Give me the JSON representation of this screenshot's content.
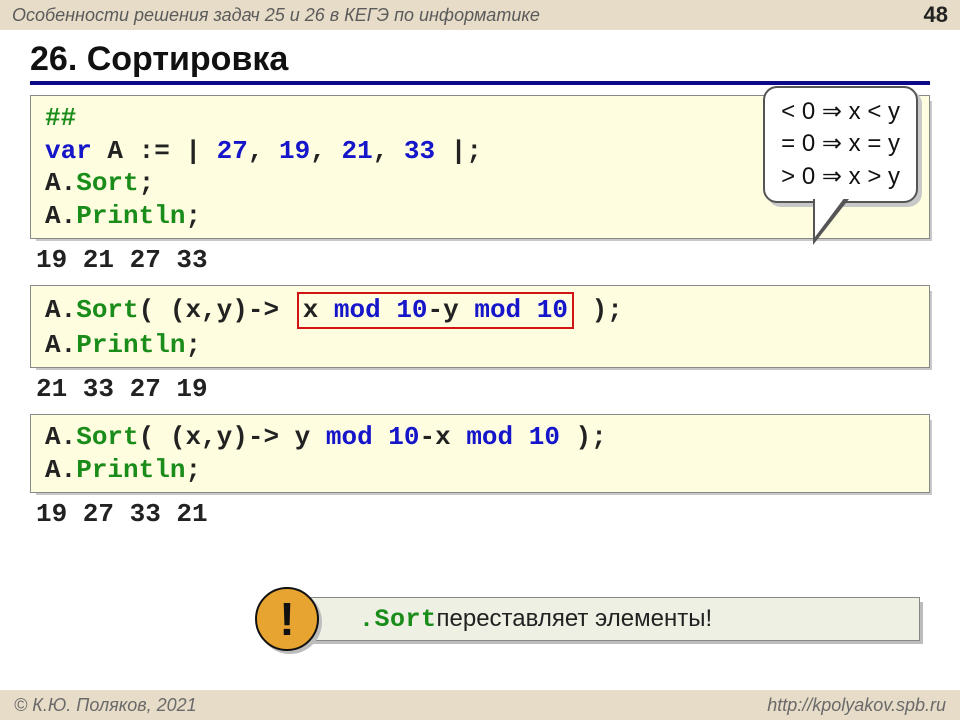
{
  "header": {
    "subtitle": "Особенности решения задач 25 и 26 в КЕГЭ по информатике",
    "page": "48"
  },
  "title": "26. Сортировка",
  "code1": {
    "l1": "##",
    "l2a": "var",
    "l2b": " A := |",
    "l2c": " 27",
    "l2d": ",",
    "l2e": " 19",
    "l2f": ",",
    "l2g": " 21",
    "l2h": ",",
    "l2i": " 33",
    "l2j": " |;",
    "l3a": "A.",
    "l3b": "Sort",
    "l3c": ";",
    "l4a": "A.",
    "l4b": "Println",
    "l4c": ";"
  },
  "out1": "19 21 27 33",
  "code2": {
    "l1a": "A.",
    "l1b": "Sort",
    "l1c": "( (x,y)->",
    "box_a": "x ",
    "box_b": "mod",
    "box_c": " 10",
    "box_d": "-y ",
    "box_e": "mod",
    "box_f": " 10",
    "l1end": " );",
    "l2a": "A.",
    "l2b": "Println",
    "l2c": ";"
  },
  "out2": "21 33 27 19",
  "code3": {
    "l1a": "A.",
    "l1b": "Sort",
    "l1c": "( (x,y)-> y ",
    "l1d": "mod",
    "l1e": " 10",
    "l1f": "-x ",
    "l1g": "mod",
    "l1h": " 10",
    "l1i": " );",
    "l2a": "A.",
    "l2b": "Println",
    "l2c": ";"
  },
  "out3": "19 27 33 21",
  "bubble": {
    "l1": "< 0  ⇒  x < y",
    "l2": "= 0  ⇒  x = y",
    "l3": "> 0  ⇒  x > y"
  },
  "note": {
    "bang": "!",
    "mono": ".Sort",
    "text": " переставляет элементы!"
  },
  "footer": {
    "left": "© К.Ю. Поляков, 2021",
    "right": "http://kpolyakov.spb.ru"
  }
}
